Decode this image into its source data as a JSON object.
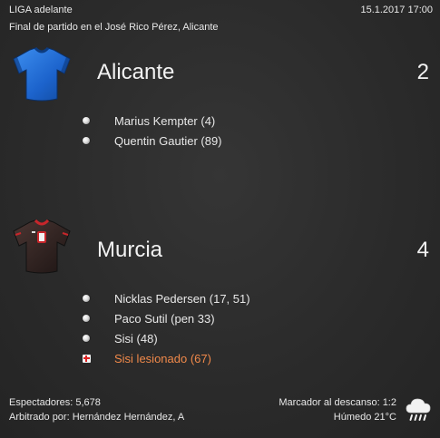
{
  "header": {
    "competition": "LIGA adelante",
    "datetime": "15.1.2017 17:00",
    "venue": "Final de partido en el José Rico Pérez, Alicante"
  },
  "home": {
    "name": "Alicante",
    "score": "2",
    "kit_icon": "jersey-blue-icon",
    "events": [
      {
        "icon": "ball-icon",
        "text": "Marius Kempter (4)"
      },
      {
        "icon": "ball-icon",
        "text": "Quentin Gautier (89)"
      }
    ]
  },
  "away": {
    "name": "Murcia",
    "score": "4",
    "kit_icon": "jersey-dark-red-icon",
    "events": [
      {
        "icon": "ball-icon",
        "text": "Nicklas Pedersen (17, 51)"
      },
      {
        "icon": "ball-icon",
        "text": "Paco Sutil (pen 33)"
      },
      {
        "icon": "ball-icon",
        "text": "Sisi (48)"
      },
      {
        "icon": "injury-icon",
        "text": "Sisi lesionado (67)"
      }
    ]
  },
  "footer": {
    "attendance": "Espectadores: 5,678",
    "referee": "Arbitrado por: Hernández Hernández, A",
    "halftime": "Marcador al descanso: 1:2",
    "weather": "Húmedo 21°C",
    "weather_icon": "rain-cloud-icon"
  },
  "colors": {
    "background": "#2b2b2b",
    "text": "#e8e8e8",
    "injury": "#f0894a",
    "home_kit": "#1f6fd6",
    "away_kit": "#3a2a28"
  }
}
